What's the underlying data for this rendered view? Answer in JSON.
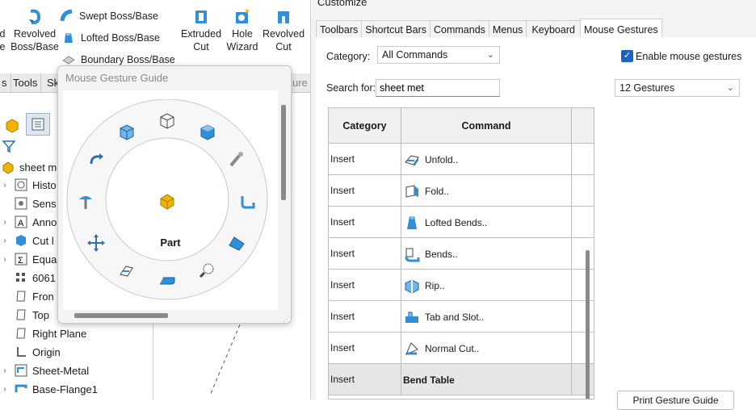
{
  "ribbon": {
    "revolved_boss_label_1": "Revolved",
    "revolved_boss_label_2": "Boss/Base",
    "left_cut_label_1": "d",
    "left_cut_label_2": "e",
    "swept_boss": "Swept Boss/Base",
    "lofted_boss": "Lofted Boss/Base",
    "boundary_boss": "Boundary Boss/Base",
    "extruded_cut_1": "Extruded",
    "extruded_cut_2": "Cut",
    "hole_wizard_1": "Hole",
    "hole_wizard_2": "Wizard",
    "revolved_cut_1": "Revolved",
    "revolved_cut_2": "Cut"
  },
  "sw_tabs": [
    "s",
    "Tools",
    "Sk",
    "ure"
  ],
  "tree": {
    "root": "sheet me",
    "items": [
      "Histo",
      "Sens",
      "Anno",
      "Cut l",
      "Equa",
      "6061",
      "Fron",
      "Top",
      "Right Plane",
      "Origin",
      "Sheet-Metal",
      "Base-Flange1"
    ]
  },
  "guide": {
    "title": "Mouse Gesture Guide",
    "center_label": "Part",
    "gesture_icons": [
      "top-view-icon",
      "isometric-cube-icon",
      "shaded-cube-icon",
      "pin-tool-icon",
      "sheet-metal-bend-icon",
      "flatten-icon",
      "magnify-search-icon",
      "fold-icon",
      "unfold-icon",
      "move-arrows-icon",
      "selection-tool-icon",
      "rotate-arrow-icon",
      "front-view-icon"
    ]
  },
  "dialog": {
    "title": "Customize",
    "tabs": [
      "Toolbars",
      "Shortcut Bars",
      "Commands",
      "Menus",
      "Keyboard",
      "Mouse Gestures"
    ],
    "active_tab": "Mouse Gestures",
    "category_label": "Category:",
    "category_value": "All Commands",
    "search_label": "Search for:",
    "search_value": "sheet met",
    "enable_label": "Enable mouse gestures",
    "enable_checked": true,
    "gestures_value": "12 Gestures",
    "table": {
      "headers": [
        "Category",
        "Command"
      ],
      "rows": [
        {
          "category": "Insert",
          "command": "Unfold..",
          "icon": "unfold-icon"
        },
        {
          "category": "Insert",
          "command": "Fold..",
          "icon": "fold-icon"
        },
        {
          "category": "Insert",
          "command": "Lofted Bends..",
          "icon": "lofted-bends-icon"
        },
        {
          "category": "Insert",
          "command": "Bends..",
          "icon": "bends-icon"
        },
        {
          "category": "Insert",
          "command": "Rip..",
          "icon": "rip-icon"
        },
        {
          "category": "Insert",
          "command": "Tab and Slot..",
          "icon": "tab-slot-icon"
        },
        {
          "category": "Insert",
          "command": "Normal Cut..",
          "icon": "normal-cut-icon"
        },
        {
          "category": "Insert",
          "command": "Bend Table",
          "icon": "",
          "bold": true,
          "selected": true
        }
      ]
    },
    "bottom_button": "Print Gesture Guide"
  },
  "colors": {
    "accent": "#1a63c0",
    "sw_blue": "#2f8fd8",
    "sw_gold": "#f0b400"
  }
}
